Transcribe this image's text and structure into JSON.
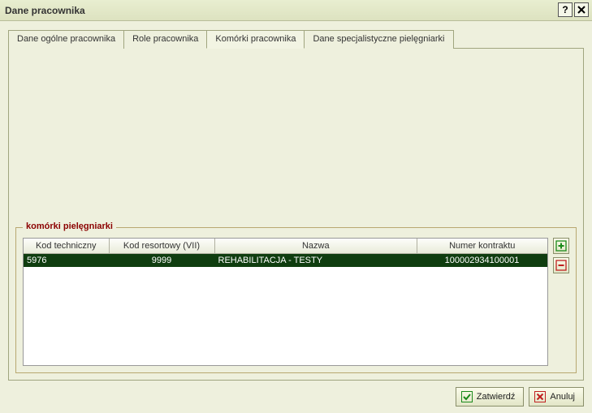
{
  "window": {
    "title": "Dane pracownika"
  },
  "tabs": [
    {
      "label": "Dane ogólne pracownika"
    },
    {
      "label": "Role pracownika"
    },
    {
      "label": "Komórki pracownika"
    },
    {
      "label": "Dane specjalistyczne pielęgniarki"
    }
  ],
  "fieldset": {
    "legend": "komórki pielęgniarki"
  },
  "table": {
    "headers": {
      "kod_techniczny": "Kod techniczny",
      "kod_resortowy": "Kod resortowy (VII)",
      "nazwa": "Nazwa",
      "numer_kontraktu": "Numer kontraktu"
    },
    "rows": [
      {
        "kod_techniczny": "5976",
        "kod_resortowy": "9999",
        "nazwa": "REHABILITACJA - TESTY",
        "numer_kontraktu": "100002934100001"
      }
    ]
  },
  "buttons": {
    "confirm": "Zatwierdź",
    "cancel": "Anuluj"
  },
  "icons": {
    "help": "?",
    "add_color": "#1a8a1a",
    "remove_color": "#c02020",
    "confirm_color": "#1a8a1a",
    "cancel_color": "#c02020"
  }
}
